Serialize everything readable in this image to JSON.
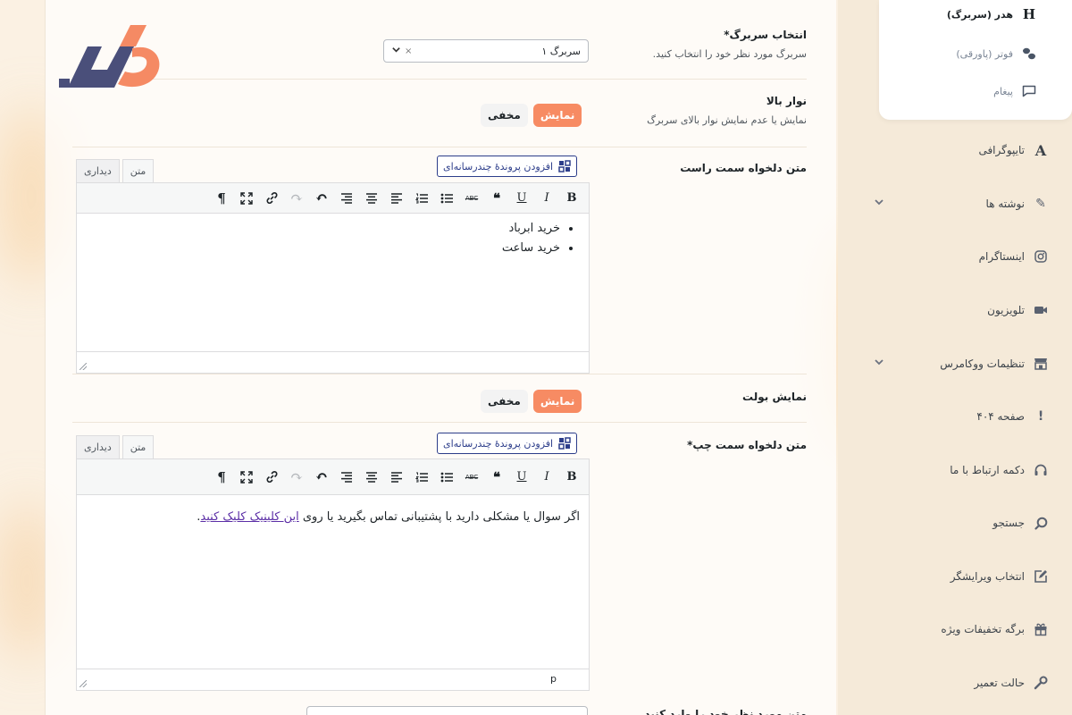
{
  "colors": {
    "accent": "#f78b63",
    "logo_navy": "#4a4f7a",
    "logo_orange": "#f58a64",
    "link": "#5b2ea6"
  },
  "sidebar": {
    "sub_items": [
      {
        "label": "هدر (سربرگ)",
        "icon": "heading-icon",
        "glyph": "H"
      },
      {
        "label": "فوتر (پاورقی)",
        "icon": "footer-icon",
        "glyph": ""
      },
      {
        "label": "پیغام",
        "icon": "message-icon",
        "glyph": ""
      }
    ],
    "items": [
      {
        "label": "تایپوگرافی",
        "icon": "typography-icon",
        "glyph": "A"
      },
      {
        "label": "نوشته ها",
        "icon": "pencil-icon",
        "glyph": "✎"
      },
      {
        "label": "اینستاگرام",
        "icon": "instagram-icon",
        "glyph": ""
      },
      {
        "label": "تلویزیون",
        "icon": "video-icon",
        "glyph": ""
      },
      {
        "label": "تنظیمات ووکامرس",
        "icon": "store-icon",
        "glyph": ""
      },
      {
        "label": "صفحه ۴۰۴",
        "icon": "exclamation-icon",
        "glyph": "!"
      },
      {
        "label": "دکمه ارتباط با ما",
        "icon": "headset-icon",
        "glyph": ""
      },
      {
        "label": "جستجو",
        "icon": "search-icon",
        "glyph": ""
      },
      {
        "label": "انتخاب ویرایشگر",
        "icon": "edit-box-icon",
        "glyph": ""
      },
      {
        "label": "برگه تخفیفات ویژه",
        "icon": "gift-icon",
        "glyph": ""
      },
      {
        "label": "حالت تعمیر",
        "icon": "wrench-icon",
        "glyph": ""
      }
    ]
  },
  "header_select": {
    "label": "انتخاب سربرگ*",
    "desc": "سربرگ مورد نظر خود را انتخاب کنید.",
    "value": "سربرگ ۱",
    "clear": "×"
  },
  "top_bar": {
    "label": "نوار بالا",
    "desc": "نمایش یا عدم نمایش نوار بالای سربرگ",
    "off": "مخفی",
    "on": "نمایش"
  },
  "right_text": {
    "label": "متن دلخواه سمت راست",
    "media_button": "افزودن پروندهٔ چندرسانه‌ای",
    "tab_visual": "دیداری",
    "tab_text": "متن",
    "bullets": [
      "خرید ابرباد",
      "خرید ساعت"
    ]
  },
  "bullet_display": {
    "label": "نمایش بولت",
    "off": "مخفی",
    "on": "نمایش"
  },
  "left_text": {
    "label": "متن دلخواه سمت چپ*",
    "media_button": "افزودن پروندهٔ چندرسانه‌ای",
    "tab_visual": "دیداری",
    "tab_text": "متن",
    "text_before": "اگر سوال یا مشکلی دارید با پشتیبانی تماس بگیرید یا روی ",
    "link_text": "این کلینیک کلیک کنید",
    "text_after": ".",
    "status_path": "p"
  },
  "toolbar": {
    "bold": "B",
    "italic": "I",
    "underline": "U",
    "quote": "❝",
    "strike": "ABC",
    "bullet_list": "",
    "numbered_list": "",
    "align_left": "",
    "align_center": "",
    "align_right": "",
    "undo": "↶",
    "redo": "↷",
    "link": "",
    "fullscreen": "",
    "rtl": "¶"
  },
  "bottom_row": {
    "label": "متن مورد نظر خود را وارد کنید"
  }
}
